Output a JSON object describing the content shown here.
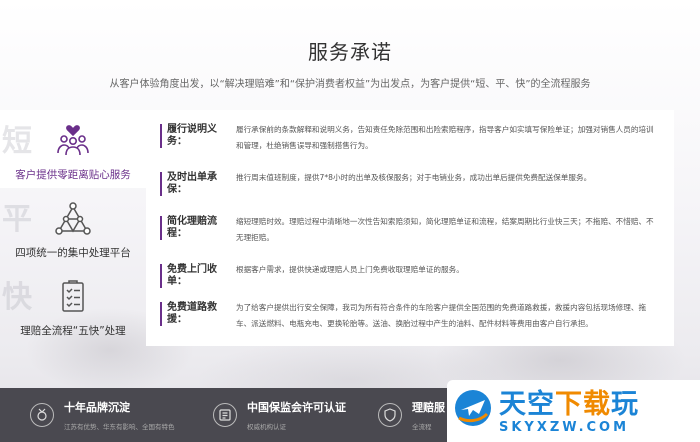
{
  "header": {
    "title": "服务承诺",
    "subtitle": "从客户体验角度出发，以“解决理赔难”和“保护消费者权益”为出发点，为客户提供“短、平、快”的全流程服务"
  },
  "nav": {
    "items": [
      {
        "bg": "短",
        "label": "客户提供零距离贴心服务",
        "icon": "team-heart-icon",
        "active": true
      },
      {
        "bg": "平",
        "label": "四项统一的集中处理平台",
        "icon": "network-triangle-icon",
        "active": false
      },
      {
        "bg": "快",
        "label": "理赔全流程“五快”处理",
        "icon": "document-checklist-icon",
        "active": false
      }
    ]
  },
  "content": {
    "rows": [
      {
        "label": "履行说明义务：",
        "text": "履行承保前的条款解释和说明义务，告知责任免除范围和出险索赔程序，指导客户如实填写保险单证；加强对销售人员的培训和管理，杜绝销售误导和强制搭售行为。"
      },
      {
        "label": "及时出单承保：",
        "text": "推行周末值班制度，提供7*8小时的出单及核保服务；对于电销业务，成功出单后提供免费配送保单服务。"
      },
      {
        "label": "简化理赔流程：",
        "text": "缩短理赔时效。理赔过程中清晰地一次性告知索赔须知，简化理赔单证和流程，结案周期比行业快三天；不拖赔、不惜赔、不无理拒赔。"
      },
      {
        "label": "免费上门收单：",
        "text": "根据客户需求，提供快递或理赔人员上门免费收取理赔单证的服务。"
      },
      {
        "label": "免费道路救援：",
        "text": "为了给客户提供出行安全保障，我司为所有符合条件的车险客户提供全国范围的免费道路救援，救援内容包括现场修理、拖车、派送燃料、电瓶充电、更换轮胎等。送油、换胎过程中产生的油料、配件材料等费用由客户自行承担。"
      }
    ]
  },
  "footer": {
    "features": [
      {
        "title": "十年品牌沉淀",
        "desc": "江苏有优势、华东有影响、全国有特色",
        "icon": "medal-icon"
      },
      {
        "title": "中国保监会许可认证",
        "desc": "权威机构认证",
        "icon": "certificate-icon"
      },
      {
        "title": "理赔服",
        "desc": "全流程",
        "icon": "shield-hand-icon"
      }
    ]
  },
  "watermark": {
    "main_blue": "天空",
    "main_orange": "下载",
    "main_blue2": "玩",
    "url": "SKYXZW.COM"
  },
  "colors": {
    "accent": "#6a2f8a",
    "footer_bg": "#4a4950",
    "watermark_blue": "#1b84d6",
    "watermark_orange": "#f08a00"
  }
}
